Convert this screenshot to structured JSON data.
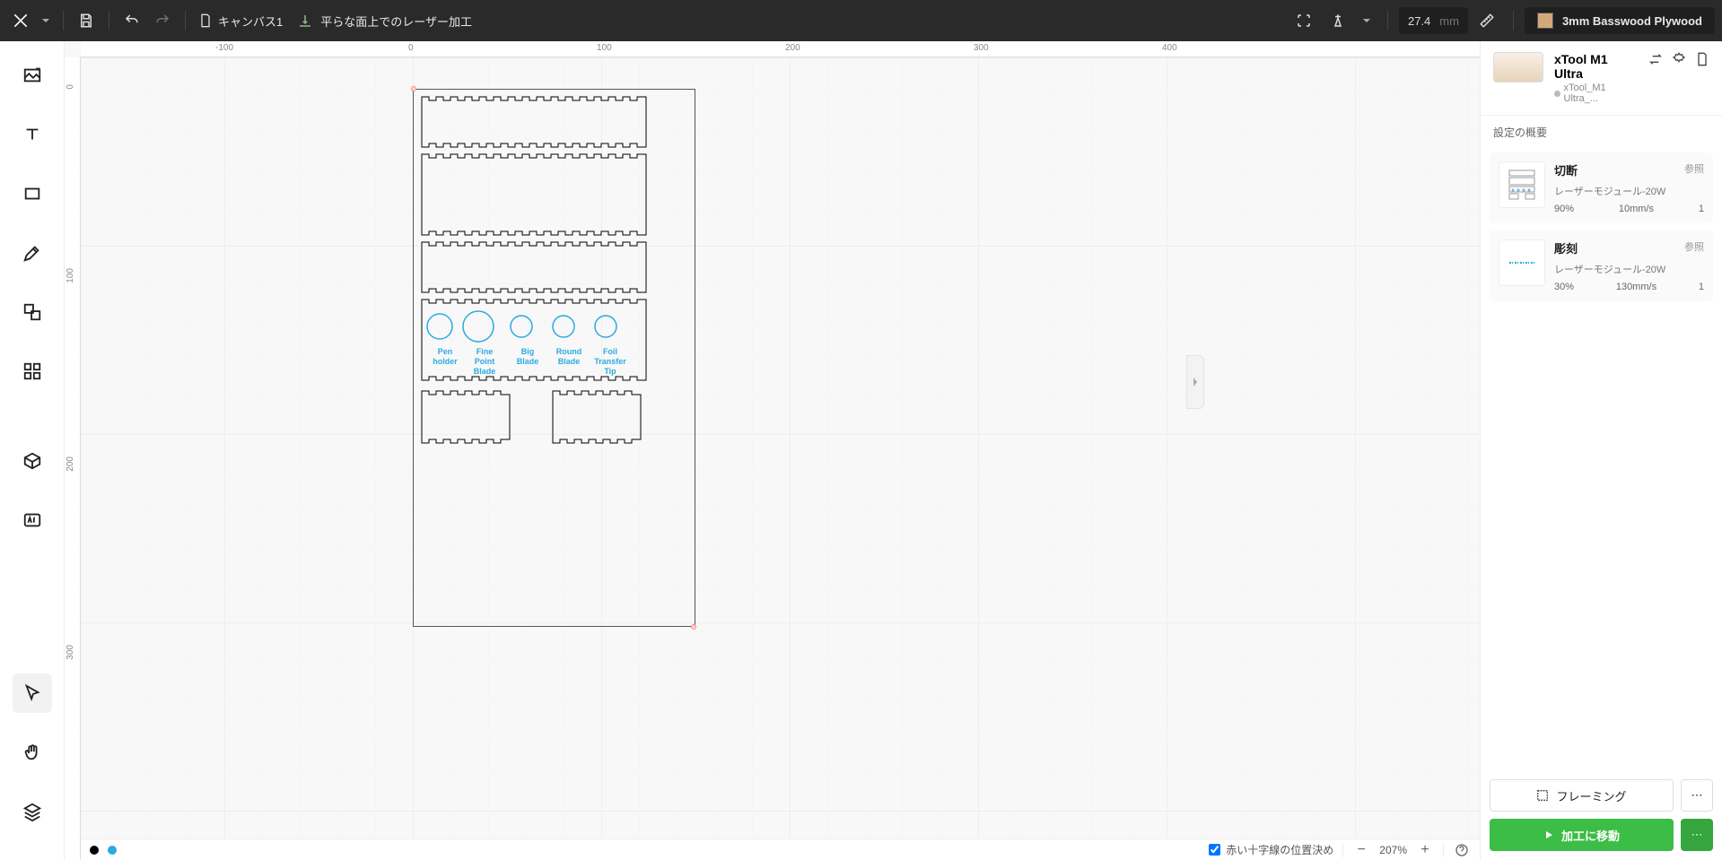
{
  "header": {
    "canvas_label": "キャンバス1",
    "laser_mode": "平らな面上でのレーザー加工",
    "thickness_value": "27.4",
    "thickness_unit": "mm",
    "material_name": "3mm Basswood Plywood"
  },
  "ruler_h": [
    "-100",
    "0",
    "100",
    "200",
    "300",
    "400"
  ],
  "ruler_v": [
    "0",
    "100",
    "200",
    "300"
  ],
  "blade_labels": [
    {
      "line1": "Pen",
      "line2": "holder",
      "line3": ""
    },
    {
      "line1": "Fine",
      "line2": "Point",
      "line3": "Blade"
    },
    {
      "line1": "Big",
      "line2": "Blade",
      "line3": ""
    },
    {
      "line1": "Round",
      "line2": "Blade",
      "line3": ""
    },
    {
      "line1": "Foil",
      "line2": "Transfer",
      "line3": "Tip"
    }
  ],
  "device": {
    "name": "xTool M1 Ultra",
    "sub": "xTool_M1 Ultra_..."
  },
  "settings_section_title": "設定の概要",
  "ops": [
    {
      "title": "切断",
      "ref": "参照",
      "module": "レーザーモジュール-20W",
      "power": "90%",
      "speed": "10mm/s",
      "passes": "1"
    },
    {
      "title": "彫刻",
      "ref": "参照",
      "module": "レーザーモジュール-20W",
      "power": "30%",
      "speed": "130mm/s",
      "passes": "1"
    }
  ],
  "buttons": {
    "framing": "フレーミング",
    "process": "加工に移動"
  },
  "statusbar": {
    "crosshair_label": "赤い十字線の位置決め",
    "zoom": "207%"
  }
}
